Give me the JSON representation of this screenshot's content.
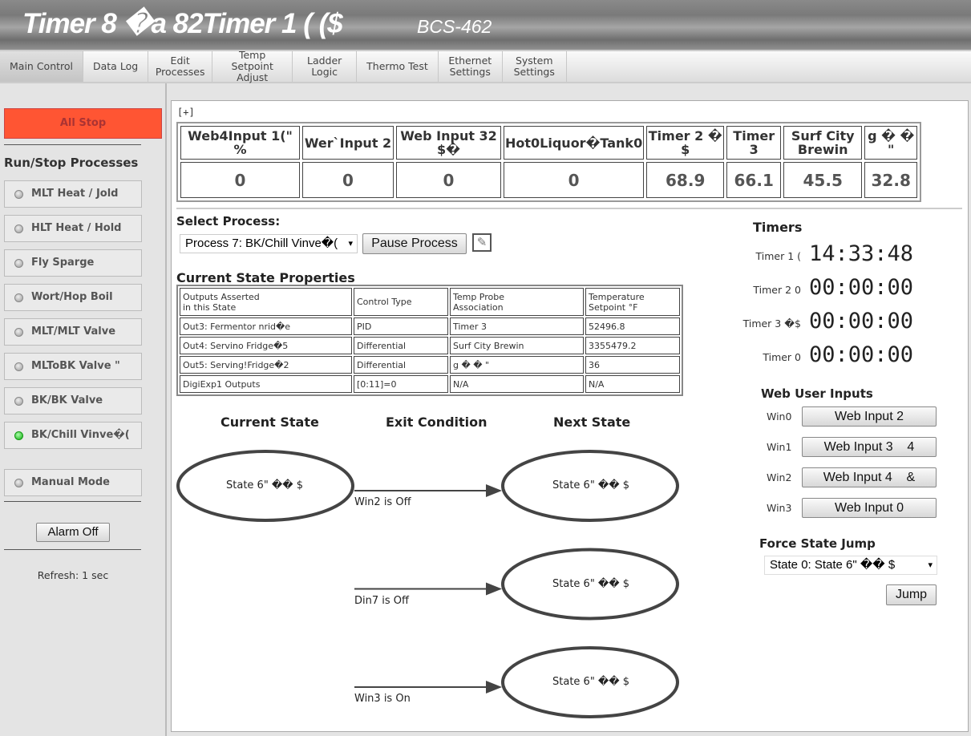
{
  "header": {
    "title": "Timer 8 �a 82Timer 1 ( ($",
    "model": "BCS-462"
  },
  "nav": [
    {
      "label": "Main Control",
      "active": true
    },
    {
      "label": "Data Log"
    },
    {
      "label": "Edit Processes"
    },
    {
      "label": "Temp Setpoint Adjust"
    },
    {
      "label": "Ladder Logic"
    },
    {
      "label": "Thermo Test"
    },
    {
      "label": "Ethernet Settings"
    },
    {
      "label": "System Settings"
    }
  ],
  "sidebar": {
    "all_stop": "All Stop",
    "run_stop_title": "Run/Stop Processes",
    "processes": [
      {
        "label": "MLT Heat / Jold",
        "on": false
      },
      {
        "label": "HLT Heat / Hold",
        "on": false
      },
      {
        "label": "Fly Sparge",
        "on": false
      },
      {
        "label": "Wort/Hop Boil",
        "on": false
      },
      {
        "label": "MLT/MLT Valve",
        "on": false
      },
      {
        "label": "MLToBK Valve \"",
        "on": false
      },
      {
        "label": "BK/BK Valve",
        "on": false
      },
      {
        "label": "BK/Chill Vinve�(",
        "on": true
      }
    ],
    "manual_mode": "Manual Mode",
    "alarm_off": "Alarm Off",
    "refresh": "Refresh:  1 sec"
  },
  "values": {
    "expand": "[+]",
    "headers": [
      "Web4Input 1(\" %",
      "Wer`Input 2",
      "Web Input 32 $�",
      "Hot0Liquor�Tank0",
      "Timer 2 � $",
      "Timer 3",
      "Surf City Brewin",
      "g � � \""
    ],
    "values": [
      "0",
      "0",
      "0",
      "0",
      "68.9",
      "66.1",
      "45.5",
      "32.8"
    ]
  },
  "process": {
    "title": "Select Process:",
    "selected": "Process 7: BK/Chill Vinve�(",
    "pause": "Pause Process",
    "edit_icon": "pencil-icon"
  },
  "state_props": {
    "title": "Current State Properties",
    "headers": [
      "Outputs Asserted\nin this State",
      "Control Type",
      "Temp Probe\nAssociation",
      "Temperature\nSetpoint °F"
    ],
    "rows": [
      [
        "Out3: Fermentor nrid�e",
        "PID",
        "Timer 3",
        "52496.8"
      ],
      [
        "Out4: Servino Fridge�5",
        "Differential",
        "Surf City Brewin",
        "3355479.2"
      ],
      [
        "Out5: Serving!Fridge�2",
        "Differential",
        "g � � \"",
        "36"
      ],
      [
        "DigiExp1 Outputs",
        "[0:11]=0",
        "N/A",
        "N/A"
      ]
    ]
  },
  "diagram": {
    "current_label": "Current State",
    "exit_label": "Exit Condition",
    "next_label": "Next State",
    "current": "State 6\" �� $",
    "transitions": [
      {
        "condition": "Win2 is Off",
        "next": "State 6\" �� $"
      },
      {
        "condition": "Din7 is Off",
        "next": "State 6\" �� $"
      },
      {
        "condition": "Win3 is On",
        "next": "State 6\" �� $"
      }
    ]
  },
  "timers": {
    "title": "Timers",
    "items": [
      {
        "label": "Timer 1 (",
        "value": "14:33:48"
      },
      {
        "label": "Timer 2 0",
        "value": "00:00:00"
      },
      {
        "label": "Timer 3 �$",
        "value": "00:00:00"
      },
      {
        "label": "Timer 0",
        "value": "00:00:00"
      }
    ]
  },
  "web_inputs": {
    "title": "Web User Inputs",
    "items": [
      {
        "id": "Win0",
        "label": "Web Input 2"
      },
      {
        "id": "Win1",
        "label": "Web Input 3    4"
      },
      {
        "id": "Win2",
        "label": "Web Input 4    &"
      },
      {
        "id": "Win3",
        "label": "Web Input 0"
      }
    ]
  },
  "force_jump": {
    "title": "Force State Jump",
    "selected": "State 0: State 6\" �� $",
    "jump": "Jump"
  },
  "colors": {
    "all_stop": "#ff5533",
    "led_on": "#22aa22"
  }
}
